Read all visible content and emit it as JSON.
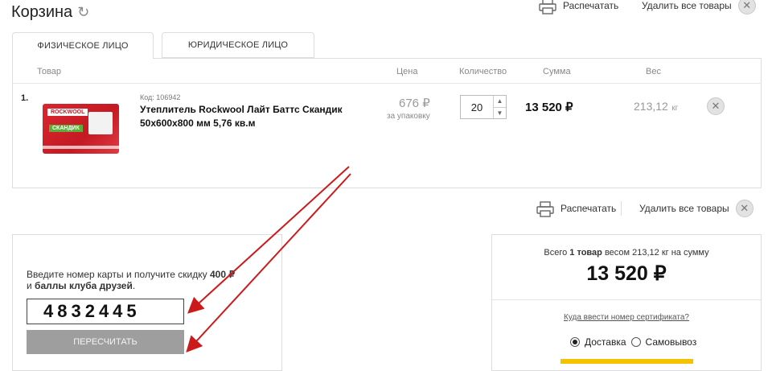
{
  "header": {
    "title": "Корзина",
    "print_label": "Распечатать",
    "delete_all_label": "Удалить все товары"
  },
  "tabs": [
    {
      "label": "ФИЗИЧЕСКОЕ ЛИЦО",
      "active": true
    },
    {
      "label": "ЮРИДИЧЕСКОЕ ЛИЦО",
      "active": false
    }
  ],
  "table": {
    "columns": {
      "product": "Товар",
      "price": "Цена",
      "quantity": "Количество",
      "sum": "Сумма",
      "weight": "Вес"
    },
    "rows": [
      {
        "index": "1.",
        "code": "Код: 106942",
        "name_line1": "Утеплитель Rockwool Лайт Баттс Скандик",
        "name_line2": "50х600х800 мм 5,76 кв.м",
        "price": "676 ₽",
        "price_unit": "за упаковку",
        "quantity": "20",
        "sum": "13 520 ₽",
        "weight": "213,12",
        "weight_unit": "кг",
        "image_brand": "ROCKWOOL",
        "image_label": "СКАНДИК"
      }
    ]
  },
  "discount": {
    "text_part1": "Введите номер карты и получите скидку ",
    "text_amount": "400 ₽",
    "text_part2": " и ",
    "text_bold": "баллы клуба друзей",
    "text_end": ".",
    "card_number": "4832445",
    "recalc_label": "ПЕРЕСЧИТАТЬ"
  },
  "total": {
    "summary_prefix": "Всего ",
    "summary_count": "1 товар",
    "summary_suffix": " весом 213,12 кг  на сумму",
    "amount": "13 520 ₽",
    "cert_link": "Куда ввести номер сертификата?",
    "delivery_label": "Доставка",
    "pickup_label": "Самовывоз",
    "delivery_selected": true
  },
  "colors": {
    "arrow": "#cc1a1a",
    "accent_yellow": "#f3c300",
    "button_gray": "#9e9e9e"
  }
}
